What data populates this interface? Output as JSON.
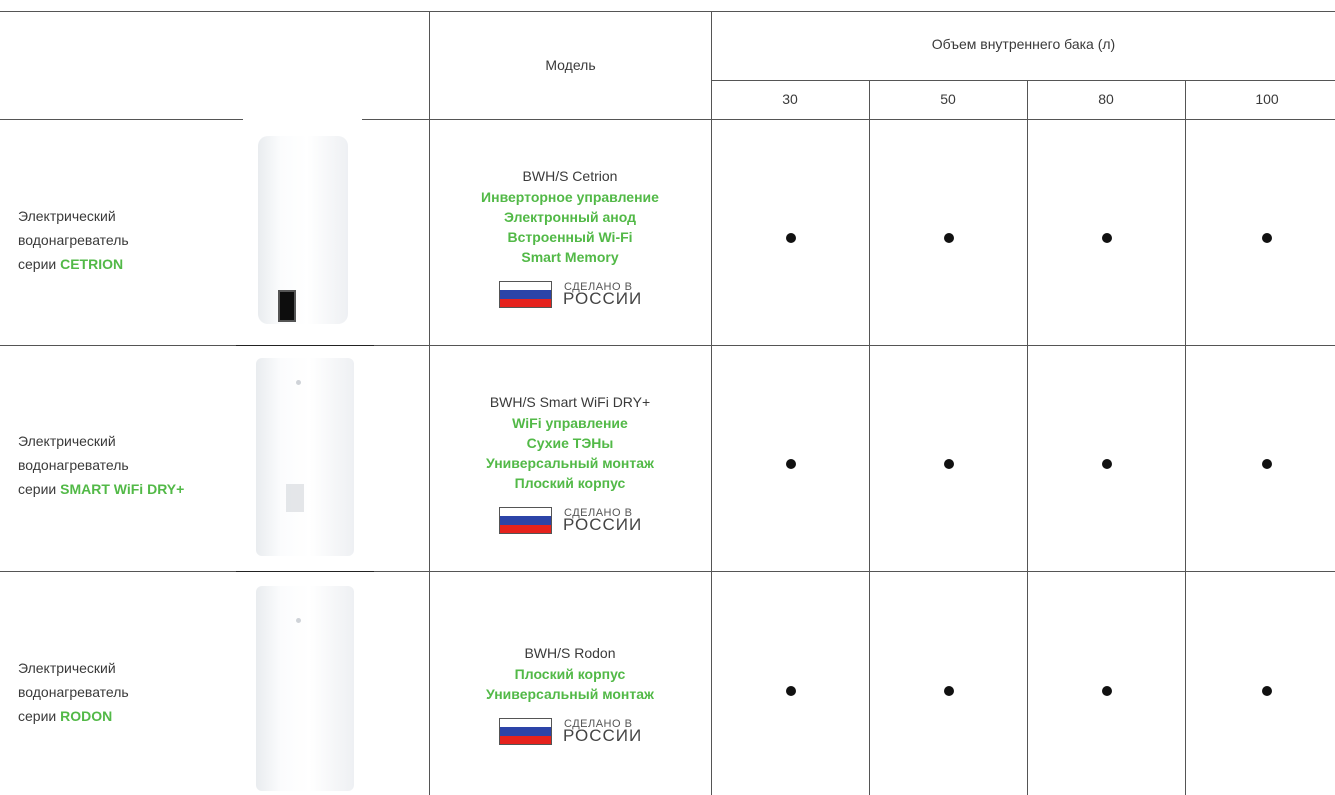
{
  "header": {
    "model_label": "Модель",
    "volume_label": "Объем внутреннего бака (л)",
    "volumes": [
      "30",
      "50",
      "80",
      "100"
    ]
  },
  "made_in": {
    "line1": "СДЕЛАНО В",
    "line2": "РОССИИ",
    "flag_colors": [
      "#ffffff",
      "#2c44a8",
      "#e5221d"
    ]
  },
  "accent_color": "#52b947",
  "rows": [
    {
      "label_line1": "Электрический",
      "label_line2": "водонагреватель",
      "label_prefix": "серии",
      "series": "CETRION",
      "model": "BWH/S Cetrion",
      "features": [
        "Инверторное управление",
        "Электронный анод",
        "Встроенный Wi-Fi",
        "Smart Memory"
      ],
      "availability": [
        "●",
        "●",
        "●",
        "●"
      ]
    },
    {
      "label_line1": "Электрический",
      "label_line2": "водонагреватель",
      "label_prefix": "серии",
      "series": "SMART WiFi DRY+",
      "model": "BWH/S Smart WiFi DRY+",
      "features": [
        "WiFi управление",
        "Сухие ТЭНы",
        "Универсальный монтаж",
        "Плоский корпус"
      ],
      "availability": [
        "●",
        "●",
        "●",
        "●"
      ]
    },
    {
      "label_line1": "Электрический",
      "label_line2": "водонагреватель",
      "label_prefix": "серии",
      "series": "RODON",
      "model": "BWH/S Rodon",
      "features": [
        "Плоский корпус",
        "Универсальный монтаж"
      ],
      "availability": [
        "●",
        "●",
        "●",
        "●"
      ]
    }
  ]
}
